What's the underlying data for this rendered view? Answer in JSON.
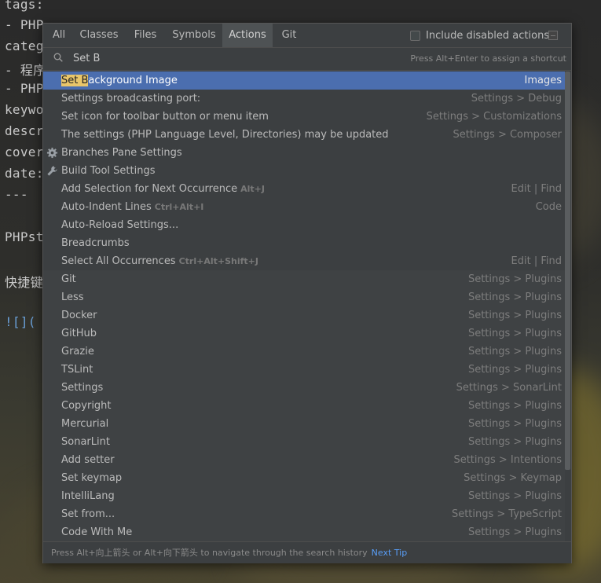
{
  "editor": {
    "lines": [
      {
        "text": "tags:",
        "cls": ""
      },
      {
        "text": "- PHP",
        "cls": ""
      },
      {
        "text": "categ",
        "cls": ""
      },
      {
        "text": "- 程序",
        "cls": ""
      },
      {
        "text": "- PHP",
        "cls": ""
      },
      {
        "text": "keywo",
        "cls": ""
      },
      {
        "text": "descr",
        "cls": ""
      },
      {
        "text": "cover",
        "cls": ""
      },
      {
        "text": "date:",
        "cls": ""
      },
      {
        "text": "---",
        "cls": ""
      },
      {
        "text": "PHPst",
        "cls": ""
      },
      {
        "text": "快捷键",
        "cls": ""
      },
      {
        "text": "![](",
        "cls": "link"
      }
    ]
  },
  "popup": {
    "tabs": [
      "All",
      "Classes",
      "Files",
      "Symbols",
      "Actions",
      "Git"
    ],
    "active_tab": "Actions",
    "include_disabled": {
      "label": "Include disabled actions",
      "checked": false
    },
    "search": {
      "value": "Set B",
      "hint": "Press Alt+Enter to assign a shortcut"
    },
    "results": [
      {
        "pre": "",
        "hl": "Set B",
        "post": "ackground Image",
        "shortcut": "",
        "category": "Images",
        "icon": "",
        "selected": true
      },
      {
        "pre": "Settings broadcasting port:",
        "hl": "",
        "post": "",
        "shortcut": "",
        "category": "Settings > Debug",
        "icon": ""
      },
      {
        "pre": "Set icon for toolbar button or menu item",
        "hl": "",
        "post": "",
        "shortcut": "",
        "category": "Settings > Customizations",
        "icon": ""
      },
      {
        "pre": "The settings (PHP Language Level, Directories) may be updated",
        "hl": "",
        "post": "",
        "shortcut": "",
        "category": "Settings > Composer",
        "icon": ""
      },
      {
        "pre": "Branches Pane Settings",
        "hl": "",
        "post": "",
        "shortcut": "",
        "category": "",
        "icon": "gear-icon"
      },
      {
        "pre": "Build Tool Settings",
        "hl": "",
        "post": "",
        "shortcut": "",
        "category": "",
        "icon": "wrench-icon"
      },
      {
        "pre": "Add Selection for Next Occurrence",
        "hl": "",
        "post": "",
        "shortcut": "Alt+J",
        "category": "Edit | Find",
        "icon": ""
      },
      {
        "pre": "Auto-Indent Lines",
        "hl": "",
        "post": "",
        "shortcut": "Ctrl+Alt+I",
        "category": "Code",
        "icon": ""
      },
      {
        "pre": "Auto-Reload Settings...",
        "hl": "",
        "post": "",
        "shortcut": "",
        "category": "",
        "icon": ""
      },
      {
        "pre": "Breadcrumbs",
        "hl": "",
        "post": "",
        "shortcut": "",
        "category": "",
        "icon": ""
      },
      {
        "pre": "Select All Occurrences",
        "hl": "",
        "post": "",
        "shortcut": "Ctrl+Alt+Shift+J",
        "category": "Edit | Find",
        "icon": ""
      },
      {
        "pre": "Git",
        "hl": "",
        "post": "",
        "shortcut": "",
        "category": "Settings > Plugins",
        "icon": ""
      },
      {
        "pre": "Less",
        "hl": "",
        "post": "",
        "shortcut": "",
        "category": "Settings > Plugins",
        "icon": ""
      },
      {
        "pre": "Docker",
        "hl": "",
        "post": "",
        "shortcut": "",
        "category": "Settings > Plugins",
        "icon": ""
      },
      {
        "pre": "GitHub",
        "hl": "",
        "post": "",
        "shortcut": "",
        "category": "Settings > Plugins",
        "icon": ""
      },
      {
        "pre": "Grazie",
        "hl": "",
        "post": "",
        "shortcut": "",
        "category": "Settings > Plugins",
        "icon": ""
      },
      {
        "pre": "TSLint",
        "hl": "",
        "post": "",
        "shortcut": "",
        "category": "Settings > Plugins",
        "icon": ""
      },
      {
        "pre": "Settings",
        "hl": "",
        "post": "",
        "shortcut": "",
        "category": "Settings > SonarLint",
        "icon": ""
      },
      {
        "pre": "Copyright",
        "hl": "",
        "post": "",
        "shortcut": "",
        "category": "Settings > Plugins",
        "icon": ""
      },
      {
        "pre": "Mercurial",
        "hl": "",
        "post": "",
        "shortcut": "",
        "category": "Settings > Plugins",
        "icon": ""
      },
      {
        "pre": "SonarLint",
        "hl": "",
        "post": "",
        "shortcut": "",
        "category": "Settings > Plugins",
        "icon": ""
      },
      {
        "pre": "Add setter",
        "hl": "",
        "post": "",
        "shortcut": "",
        "category": "Settings > Intentions",
        "icon": ""
      },
      {
        "pre": "Set keymap",
        "hl": "",
        "post": "",
        "shortcut": "",
        "category": "Settings > Keymap",
        "icon": ""
      },
      {
        "pre": "IntelliLang",
        "hl": "",
        "post": "",
        "shortcut": "",
        "category": "Settings > Plugins",
        "icon": ""
      },
      {
        "pre": "Set from...",
        "hl": "",
        "post": "",
        "shortcut": "",
        "category": "Settings > TypeScript",
        "icon": ""
      },
      {
        "pre": "Code With Me",
        "hl": "",
        "post": "",
        "shortcut": "",
        "category": "Settings > Plugins",
        "icon": ""
      }
    ],
    "footer": {
      "text": "Press Alt+向上箭头 or Alt+向下箭头 to navigate through the search history",
      "link": "Next Tip"
    }
  },
  "colors": {
    "selection": "#4b6eaf",
    "highlight": "#e9c66a",
    "link": "#589df6",
    "panel": "#3c3f41"
  }
}
